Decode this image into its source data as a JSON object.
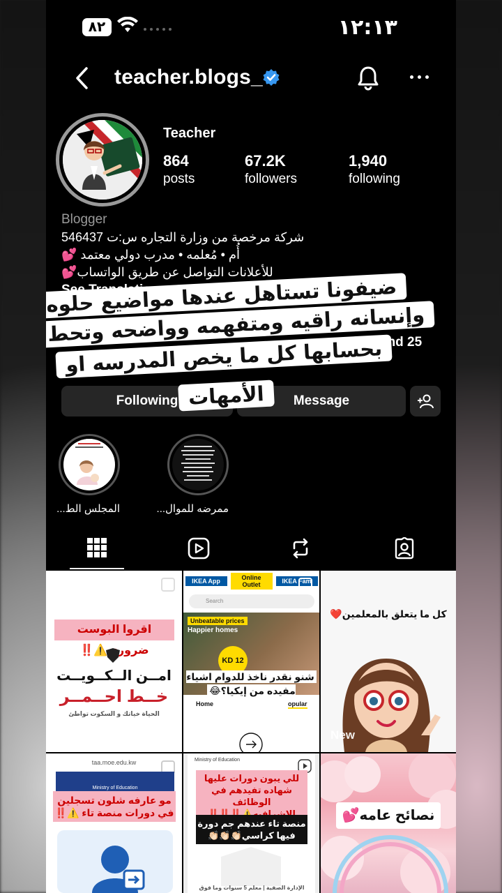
{
  "status_bar": {
    "battery": "٨٢",
    "time": "١٢:١٣"
  },
  "header": {
    "username": "teacher.blogs_"
  },
  "profile": {
    "display_name": "Teacher",
    "stats": [
      {
        "value": "864",
        "label": "posts"
      },
      {
        "value": "67.2K",
        "label": "followers"
      },
      {
        "value": "1,940",
        "label": "following"
      }
    ],
    "category": "Blogger",
    "bio_lines": [
      "شركة مرخصة من وزارة التجاره س:ت 546437",
      "أُم • مُعلمه • مدرب دولي معتمد 💕",
      "للأعلانات التواصل عن طريق الواتساب💕"
    ],
    "see_translation": "See Translation",
    "mutual_tail": "rt and 25"
  },
  "actions": {
    "following": "Following",
    "message": "Message"
  },
  "highlights": [
    {
      "label": "ممرضه للموال..."
    },
    {
      "label": "المجلس الط..."
    }
  ],
  "overlay_caption": [
    "ضيفونا تستاهل عندها مواضيع حلوه",
    "وإنسانه راقيه ومتفهمه وواضحه وتحط",
    "بحسابها كل ما يخص المدرسه او",
    "الأمهات"
  ],
  "grid": {
    "new_label": "New",
    "post1": {
      "headline": "اقروا البوست ضروري⚠️‼️",
      "brand": "امــن الــكــويــت",
      "red": "خــط احــمــر",
      "sub": "الحياة خياتك و السكوت تواطئ"
    },
    "post2": {
      "tabs": [
        "IKEA App",
        "Online Outlet",
        "IKEA Fam"
      ],
      "search": "Search",
      "banner1": "Unbeatable prices",
      "banner2": "Happier homes",
      "price": "KD 12",
      "caption": "شنو نقدر ناخذ للدوام اشياء مفيده من إيكيا؟😂",
      "home": "Home",
      "popular": "opular"
    },
    "post3": {
      "text": "كل ما يتعلق بالمعلمين❤️"
    },
    "post4": {
      "url": "taa.moe.edu.kw",
      "ministry": "Ministry of Education",
      "text": "مو عارفه شلون تسجلين في دورات منصة تاء ⚠️‼️"
    },
    "post5": {
      "ministry": "Ministry of Education",
      "text1": "للي يبون دورات عليها شهاده تفيدهم في الوظائف الاشرافيه⚠️‼️‼️‼️",
      "text2": "منصة تاء عندهم جم دورة فيها كراسي👏🏻👏🏻👏🏻",
      "footer": "الإدارة الصفية | معلم 5 سنوات وما فوق"
    },
    "post6": {
      "text": "نصائح عامه💕"
    }
  },
  "colors": {
    "verified": "#3797f0",
    "red_heart": "#e0245e",
    "post_pink": "#f6b3c0"
  }
}
